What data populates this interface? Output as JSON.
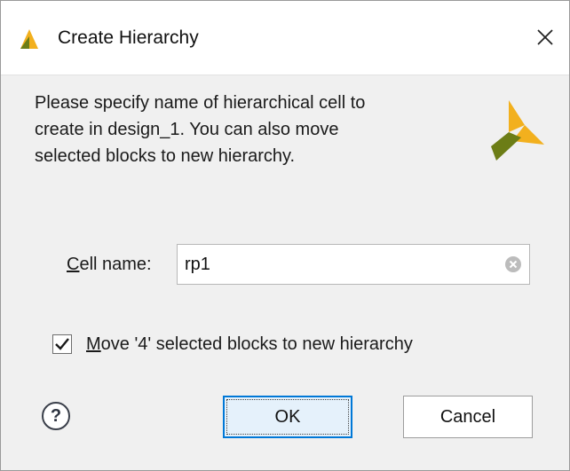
{
  "window": {
    "title": "Create Hierarchy",
    "logo_icon": "xilinx-logo-icon",
    "close_icon": "close-icon",
    "close_glyph": "✕"
  },
  "description": {
    "lines": [
      "Please specify name of hierarchical cell to",
      "create in design_1. You can also move",
      "selected blocks to new hierarchy."
    ],
    "brand_icon": "xilinx-logo-icon"
  },
  "cell_name": {
    "label_mnemonic": "C",
    "label_rest": "ell name:",
    "value": "rp1",
    "placeholder": "",
    "clear_icon": "clear-icon"
  },
  "move_option": {
    "checked": true,
    "label_mnemonic": "M",
    "label_rest": "ove '4' selected blocks to new hierarchy"
  },
  "buttons": {
    "help": "?",
    "help_icon": "help-icon",
    "ok": "OK",
    "cancel": "Cancel"
  },
  "colors": {
    "logo_light": "#f2b01e",
    "logo_dark": "#6c7d16",
    "focus_blue": "#0078d7",
    "dialog_bg": "#f0f0f0"
  }
}
